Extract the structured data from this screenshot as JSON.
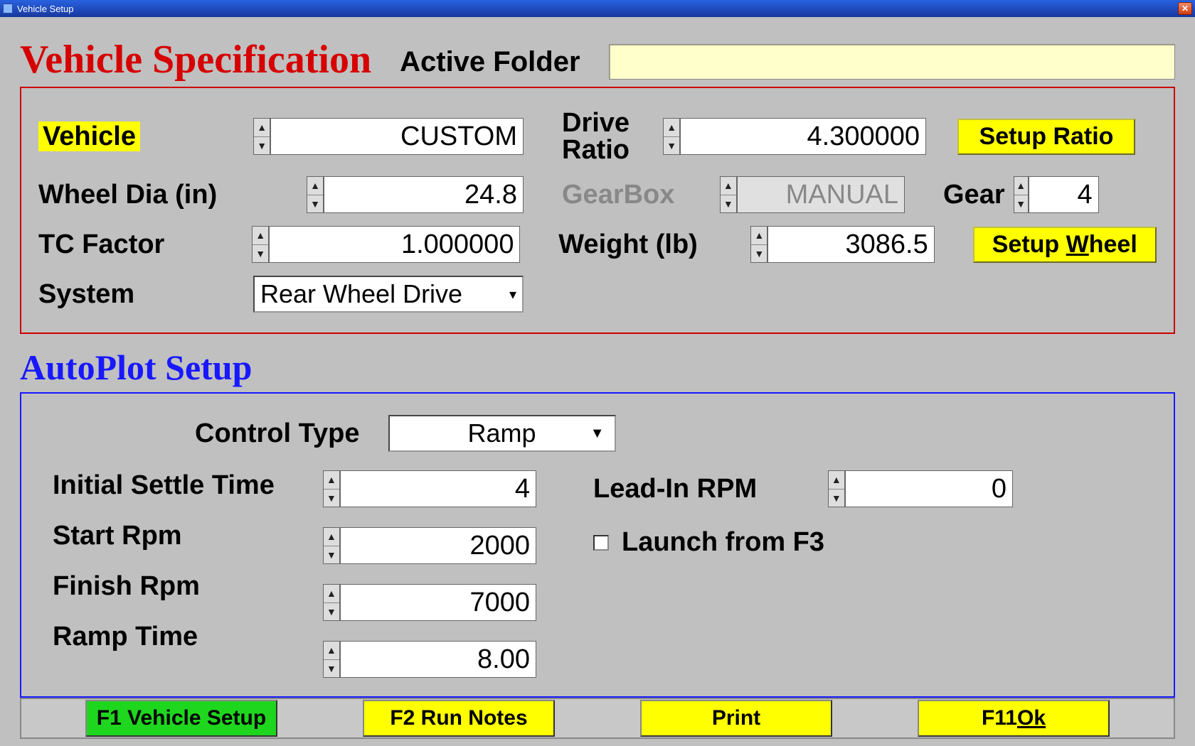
{
  "window": {
    "title": "Vehicle Setup"
  },
  "vehicle_spec": {
    "section_title": "Vehicle Specification",
    "active_folder_label": "Active Folder",
    "active_folder_value": "",
    "vehicle_label": "Vehicle",
    "vehicle_value": "CUSTOM",
    "drive_ratio_label": "Drive\nRatio",
    "drive_ratio_value": "4.300000",
    "setup_ratio_btn": "Setup Ratio",
    "wheel_dia_label": "Wheel Dia (in)",
    "wheel_dia_value": "24.8",
    "gearbox_label": "GearBox",
    "gearbox_value": "MANUAL",
    "gear_label": "Gear",
    "gear_value": "4",
    "tc_factor_label": "TC Factor",
    "tc_factor_value": "1.000000",
    "weight_label": "Weight (lb)",
    "weight_value": "3086.5",
    "setup_wheel_btn": "Setup Wheel",
    "system_label": "System",
    "system_value": "Rear Wheel Drive"
  },
  "autoplot": {
    "section_title": "AutoPlot Setup",
    "control_type_label": "Control Type",
    "control_type_value": "Ramp",
    "initial_settle_label": "Initial Settle Time",
    "initial_settle_value": "4",
    "leadin_label": "Lead-In RPM",
    "leadin_value": "0",
    "start_rpm_label": "Start Rpm",
    "start_rpm_value": "2000",
    "launch_f3_label": "Launch from F3",
    "launch_f3_checked": false,
    "finish_rpm_label": "Finish Rpm",
    "finish_rpm_value": "7000",
    "ramp_time_label": "Ramp Time",
    "ramp_time_value": "8.00"
  },
  "buttons": {
    "f1": "F1 Vehicle Setup",
    "f2": "F2 Run Notes",
    "print": "Print",
    "f11_prefix": "F11 ",
    "f11_ok": "Ok"
  }
}
